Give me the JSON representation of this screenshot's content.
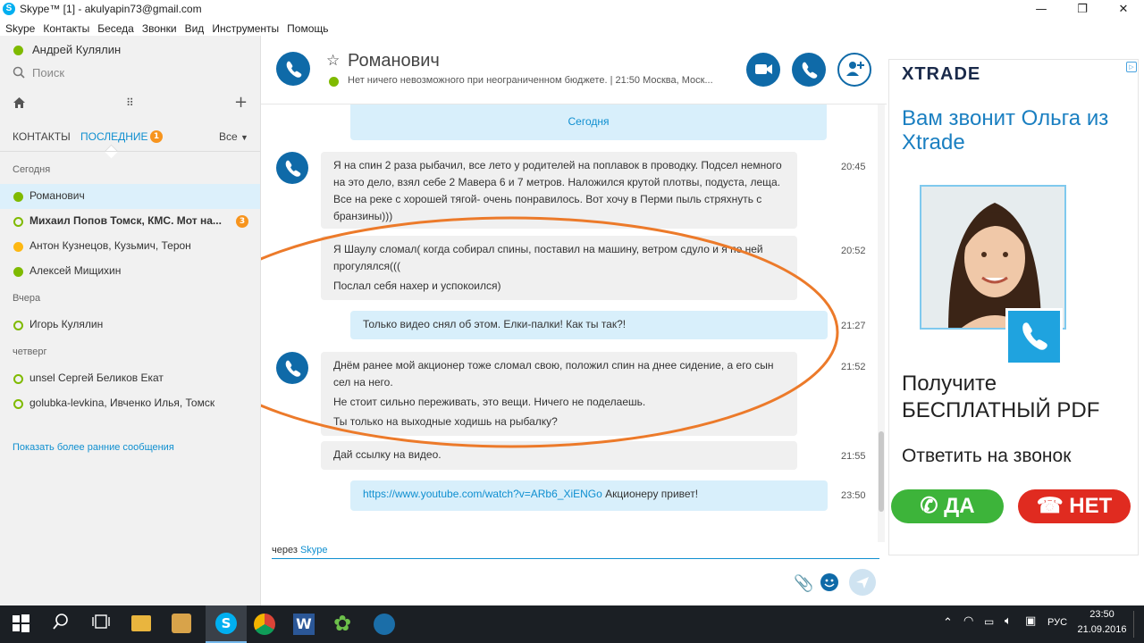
{
  "window": {
    "title": "Skype™ [1] - akulyapin73@gmail.com",
    "logo_letter": "S",
    "minimize": "—",
    "maximize": "❐",
    "close": "✕"
  },
  "menu": [
    "Skype",
    "Контакты",
    "Беседа",
    "Звонки",
    "Вид",
    "Инструменты",
    "Помощь"
  ],
  "left": {
    "user_name": "Андрей Кулялин",
    "search_placeholder": "Поиск",
    "tab_contacts": "КОНТАКТЫ",
    "tab_recent": "ПОСЛЕДНИЕ",
    "recent_badge": "1",
    "filter_label": "Все",
    "sections": [
      {
        "title": "Сегодня",
        "items": [
          {
            "name": "Романович",
            "status": "online",
            "selected": true,
            "bold": false,
            "badge": ""
          },
          {
            "name": "Михаил Попов Томск, КМС. Мот на...",
            "status": "hollow",
            "selected": false,
            "bold": true,
            "badge": "3"
          },
          {
            "name": "Антон Кузнецов, Кузьмич, Терон",
            "status": "away",
            "selected": false,
            "bold": false,
            "badge": ""
          },
          {
            "name": "Алексей Мищихин",
            "status": "online",
            "selected": false,
            "bold": false,
            "badge": ""
          }
        ]
      },
      {
        "title": "Вчера",
        "items": [
          {
            "name": "Игорь Кулялин",
            "status": "hollow",
            "selected": false,
            "bold": false,
            "badge": ""
          }
        ]
      },
      {
        "title": "четверг",
        "items": [
          {
            "name": "unsel Сергей Беликов Екат",
            "status": "hollow",
            "selected": false,
            "bold": false,
            "badge": ""
          },
          {
            "name": "golubka-levkina, Ивченко Илья, Томск",
            "status": "hollow",
            "selected": false,
            "bold": false,
            "badge": ""
          }
        ]
      }
    ],
    "show_earlier": "Показать более ранние сообщения"
  },
  "chat": {
    "contact_name": "Романович",
    "mood": "Нет ничего невозможного при неограниченном бюджете.  |  21:50 Москва, Моск...",
    "date_divider": "Сегодня",
    "messages": [
      {
        "from": "them",
        "time": "20:45",
        "paragraphs": [
          "Я на спин 2 раза рыбачил, все лето у родителей на поплавок в проводку. Подсел немного на это дело, взял себе 2 Мавера 6 и 7 метров. Наложился крутой плотвы, подуста, леща. Все на реке с хорошей тягой- очень понравилось. Вот хочу в Перми пыль стряхнуть с бранзины)))"
        ]
      },
      {
        "from": "them",
        "time": "20:52",
        "paragraphs": [
          "Я Шаулу сломал( когда собирал спины, поставил на машину, ветром сдуло и я по ней прогулялся(((",
          "Послал себя нахер и успокоился)"
        ]
      },
      {
        "from": "me",
        "time": "21:27",
        "paragraphs": [
          "Только видео снял об этом. Елки-палки! Как ты так?!"
        ]
      },
      {
        "from": "them",
        "time": "21:52",
        "paragraphs": [
          "Днём ранее мой акционер тоже сломал свою, положил спин на днее сидение, а его сын сел на него.",
          "Не стоит сильно переживать, это вещи. Ничего не поделаешь.",
          "Ты только на выходные ходишь на рыбалку?"
        ]
      },
      {
        "from": "them",
        "time": "21:55",
        "paragraphs": [
          "Дай ссылку на видео."
        ]
      },
      {
        "from": "me",
        "time": "23:50",
        "link": "https://www.youtube.com/watch?v=ARb6_XiENGo",
        "after_link": " Акционеру привет!"
      }
    ],
    "via_prefix": "через",
    "via_link": "Skype"
  },
  "ad": {
    "brand": "XTRADE",
    "headline": "Вам звонит Ольга из Xtrade",
    "offer": "Получите БЕСПЛАТНЫЙ PDF",
    "cta": "Ответить на звонок",
    "yes": "ДА",
    "no": "НЕТ"
  },
  "taskbar": {
    "lang": "РУС",
    "time": "23:50",
    "date": "21.09.2016"
  },
  "colors": {
    "skype_blue": "#0f6aa8",
    "accent_blue": "#00aff0",
    "online_green": "#7fba00",
    "annotation_orange": "#ec7a2a",
    "ad_blue": "#1a7fc1"
  }
}
